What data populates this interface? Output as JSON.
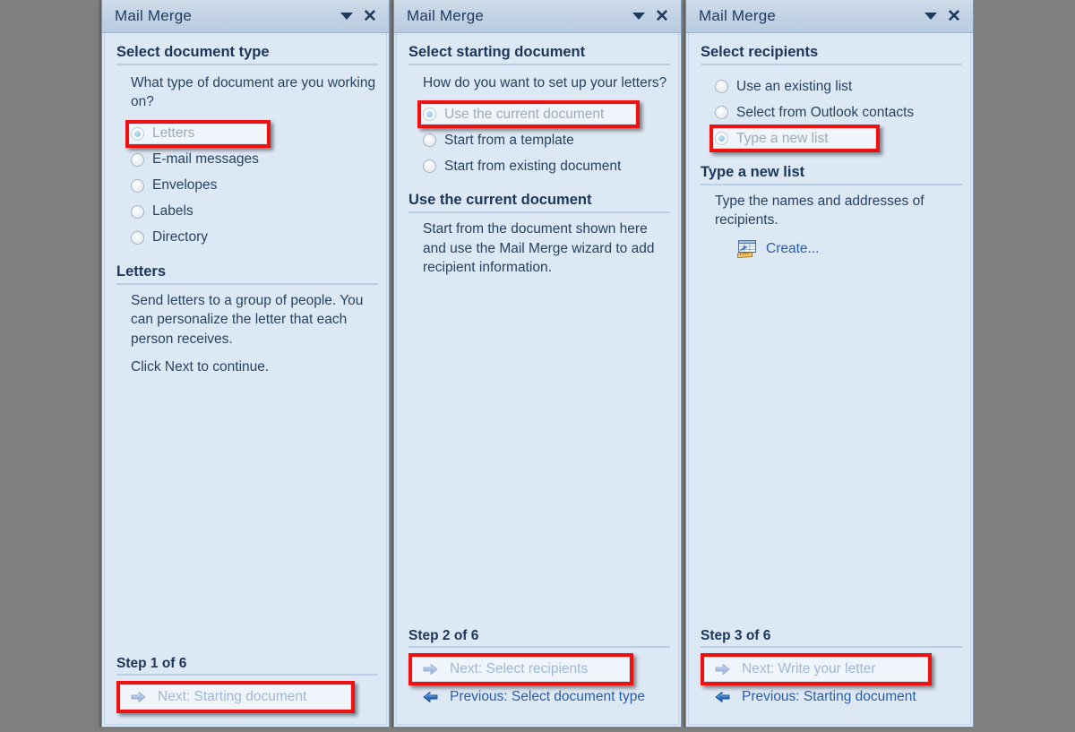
{
  "window": {
    "title": "Mail Merge",
    "caret_icon": "chevron-down-icon",
    "close_icon": "close-icon"
  },
  "panels": [
    {
      "id": "step1",
      "title": "Mail Merge",
      "section_heading": "Select document type",
      "prompt": "What type of document are you working on?",
      "options": [
        {
          "label": "Letters",
          "selected": true,
          "highlighted": true
        },
        {
          "label": "E-mail messages",
          "selected": false,
          "highlighted": false
        },
        {
          "label": "Envelopes",
          "selected": false,
          "highlighted": false
        },
        {
          "label": "Labels",
          "selected": false,
          "highlighted": false
        },
        {
          "label": "Directory",
          "selected": false,
          "highlighted": false
        }
      ],
      "detail_heading": "Letters",
      "detail_paragraphs": [
        "Send letters to a group of people. You can personalize the letter that each person receives.",
        "Click Next to continue."
      ],
      "step_label": "Step 1 of 6",
      "nav": [
        {
          "label": "Next: Starting document",
          "direction": "next",
          "icon": "arrow-right-icon",
          "highlighted": true
        }
      ]
    },
    {
      "id": "step2",
      "title": "Mail Merge",
      "section_heading": "Select starting document",
      "prompt": "How do you want to set up your letters?",
      "options": [
        {
          "label": "Use the current document",
          "selected": true,
          "highlighted": true
        },
        {
          "label": "Start from a template",
          "selected": false,
          "highlighted": false
        },
        {
          "label": "Start from existing document",
          "selected": false,
          "highlighted": false
        }
      ],
      "detail_heading": "Use the current document",
      "detail_paragraphs": [
        "Start from the document shown here and use the Mail Merge wizard to add recipient information."
      ],
      "step_label": "Step 2 of 6",
      "nav": [
        {
          "label": "Next: Select recipients",
          "direction": "next",
          "icon": "arrow-right-icon",
          "highlighted": true
        },
        {
          "label": "Previous: Select document type",
          "direction": "previous",
          "icon": "arrow-left-icon",
          "highlighted": false
        }
      ]
    },
    {
      "id": "step3",
      "title": "Mail Merge",
      "section_heading": "Select recipients",
      "prompt": "",
      "options": [
        {
          "label": "Use an existing list",
          "selected": false,
          "highlighted": false
        },
        {
          "label": "Select from Outlook contacts",
          "selected": false,
          "highlighted": false
        },
        {
          "label": "Type a new list",
          "selected": true,
          "highlighted": true
        }
      ],
      "detail_heading": "Type a new list",
      "detail_paragraphs": [
        "Type the names and addresses of recipients."
      ],
      "action_link": {
        "label": "Create...",
        "icon": "new-address-list-icon"
      },
      "step_label": "Step 3 of 6",
      "nav": [
        {
          "label": "Next: Write your letter",
          "direction": "next",
          "icon": "arrow-right-icon",
          "highlighted": true
        },
        {
          "label": "Previous: Starting document",
          "direction": "previous",
          "icon": "arrow-left-icon",
          "highlighted": false
        }
      ]
    }
  ],
  "colors": {
    "background": "#7f7f7f",
    "panel_body": "#dde8f5",
    "titlebar": "#c2d2e4",
    "heading_text": "#1c3659",
    "body_text": "#26435f",
    "link": "#2a5da8",
    "highlight_box": "#ee1111",
    "radio_selected": "#1e8ed0",
    "rule": "#b9cee2"
  }
}
